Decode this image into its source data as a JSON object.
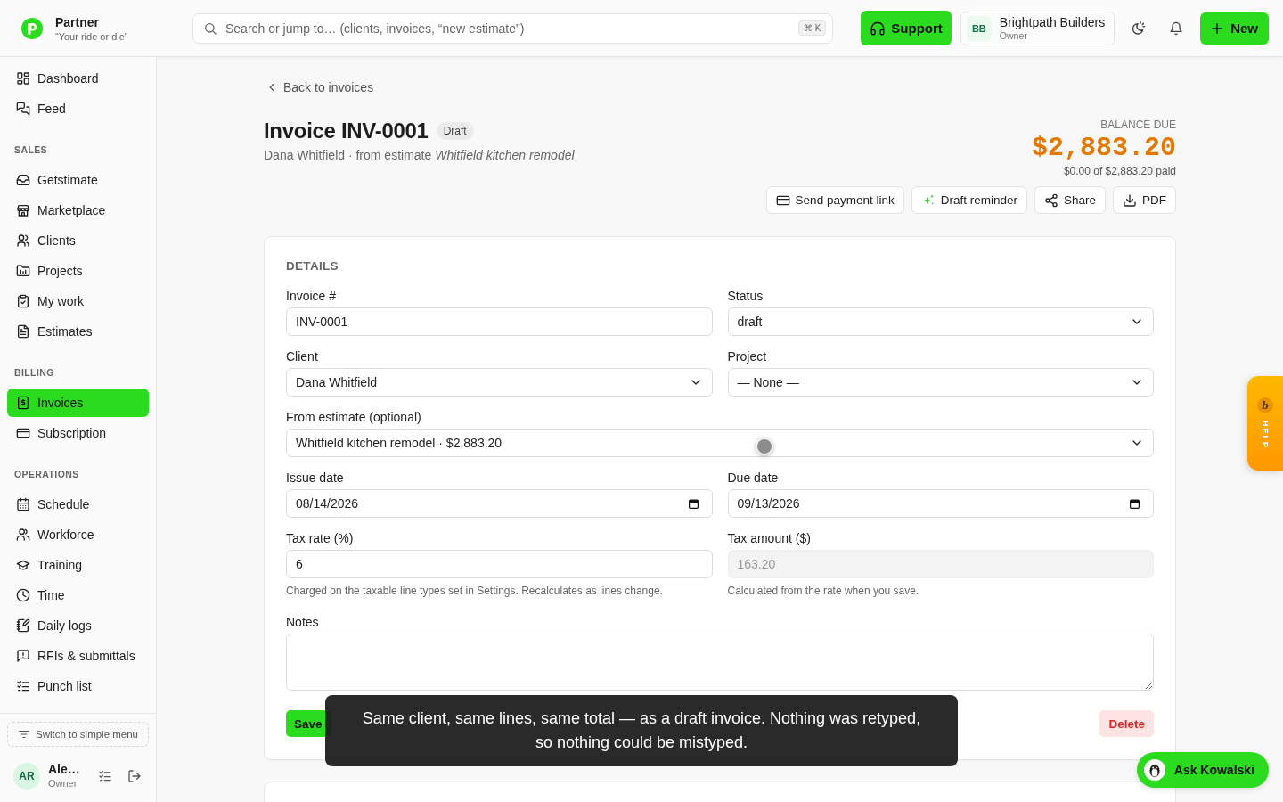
{
  "topbar": {
    "brand": {
      "name": "Partner",
      "tagline": "“Your ride or die”"
    },
    "search": {
      "placeholder": "Search or jump to… (clients, invoices, “new estimate”)",
      "shortcut": "⌘ K"
    },
    "support_button": "Support",
    "org": {
      "initials": "BB",
      "name": "Brightpath Builders",
      "role": "Owner"
    },
    "new_button": "New"
  },
  "sidebar": {
    "sections": [
      {
        "items": [
          {
            "label": "Dashboard",
            "selected": false
          },
          {
            "label": "Feed",
            "selected": false
          }
        ]
      },
      {
        "heading": "SALES",
        "items": [
          {
            "label": "Getstimate",
            "selected": false
          },
          {
            "label": "Marketplace",
            "selected": false
          },
          {
            "label": "Clients",
            "selected": false
          },
          {
            "label": "Projects",
            "selected": false
          },
          {
            "label": "My work",
            "selected": false
          },
          {
            "label": "Estimates",
            "selected": false
          }
        ]
      },
      {
        "heading": "BILLING",
        "items": [
          {
            "label": "Invoices",
            "selected": true
          },
          {
            "label": "Subscription",
            "selected": false
          }
        ]
      },
      {
        "heading": "OPERATIONS",
        "items": [
          {
            "label": "Schedule",
            "selected": false
          },
          {
            "label": "Workforce",
            "selected": false
          },
          {
            "label": "Training",
            "selected": false
          },
          {
            "label": "Time",
            "selected": false
          },
          {
            "label": "Daily logs",
            "selected": false
          },
          {
            "label": "RFIs & submittals",
            "selected": false
          },
          {
            "label": "Punch list",
            "selected": false
          }
        ]
      }
    ],
    "switch_button": "Switch to simple menu",
    "user": {
      "initials": "AR",
      "name": "Ale…",
      "role": "Owner"
    }
  },
  "page": {
    "back_link": "Back to invoices",
    "title": "Invoice INV-0001",
    "status_badge": "Draft",
    "subtitle": "Dana Whitfield · from estimate *Whitfield kitchen remodel*",
    "balance": {
      "label": "BALANCE DUE",
      "amount": "$2,883.20",
      "paid": "$0.00 of $2,883.20 paid"
    },
    "actions": [
      {
        "label": "Send payment link"
      },
      {
        "label": "Draft reminder"
      },
      {
        "label": "Share"
      },
      {
        "label": "PDF"
      }
    ]
  },
  "details": {
    "heading": "DETAILS",
    "rows": [
      [
        {
          "label": "Invoice #",
          "kind": "text",
          "value": "INV-0001",
          "disabled": false
        },
        {
          "label": "Status",
          "kind": "select",
          "value": "draft",
          "disabled": false
        }
      ],
      [
        {
          "label": "Client",
          "kind": "select",
          "value": "Dana Whitfield",
          "disabled": false
        },
        {
          "label": "Project",
          "kind": "select",
          "value": "— None —",
          "disabled": false
        }
      ],
      [
        {
          "label": "From estimate (optional)",
          "kind": "select",
          "value": "Whitfield kitchen remodel · $2,883.20",
          "disabled": false
        }
      ],
      [
        {
          "label": "Issue date",
          "kind": "date",
          "value": "08/14/2026",
          "disabled": false
        },
        {
          "label": "Due date",
          "kind": "date",
          "value": "09/13/2026",
          "disabled": false
        }
      ],
      [
        {
          "label": "Tax rate (%)",
          "kind": "text",
          "value": "6",
          "disabled": false,
          "hint": "Charged on the taxable line types set in Settings. Recalculates as lines change."
        },
        {
          "label": "Tax amount ($)",
          "kind": "text",
          "value": "163.20",
          "disabled": true,
          "hint": "Calculated from the rate when you save."
        }
      ],
      [
        {
          "label": "Notes",
          "kind": "textarea",
          "disabled": false
        }
      ]
    ],
    "buttons": [
      {
        "label": "Save",
        "kind": "primary"
      },
      {
        "label": "Delete",
        "kind": "danger"
      }
    ]
  },
  "toast": "Same client, same lines, same total — as a draft invoice. Nothing was retyped, so nothing could be mistyped.",
  "help_tab": {
    "badge": "b",
    "label": "HELP"
  },
  "assistant_button": "Ask Kowalski"
}
